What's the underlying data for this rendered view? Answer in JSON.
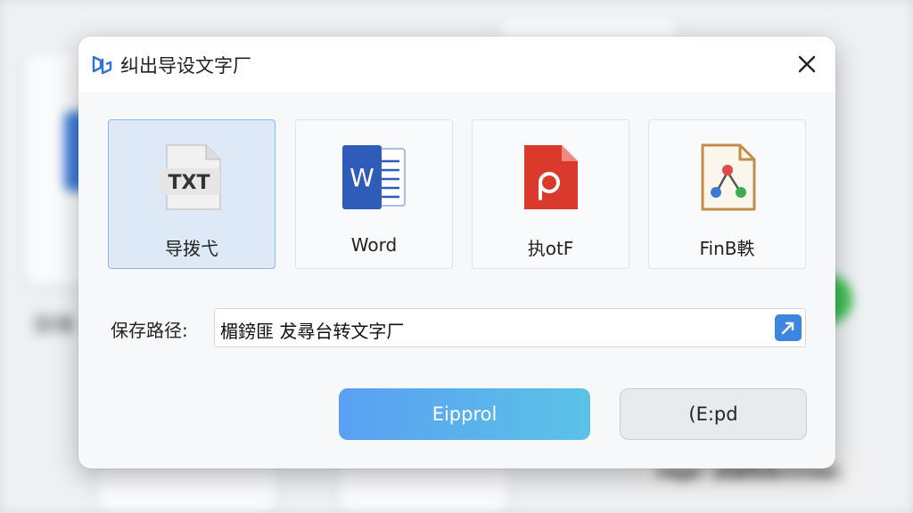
{
  "dialog": {
    "title": "纠出导设文字厂",
    "formats": [
      {
        "label": "导拨弋",
        "icon_text": "TXT",
        "icon": "txt-file-icon",
        "selected": true
      },
      {
        "label": "Word",
        "icon_text": "W",
        "icon": "word-file-icon",
        "selected": false
      },
      {
        "label": "执otF",
        "icon_text": "P",
        "icon": "pdf-file-icon",
        "selected": false
      },
      {
        "label": "FinB軼",
        "icon_text": "",
        "icon": "share-file-icon",
        "selected": false
      }
    ],
    "save_path": {
      "label": "保存路径:",
      "value": "楣鎊匪 犮尋台转文字厂"
    },
    "primary_button": "Eipprol",
    "secondary_button": "(E:pd"
  },
  "background": {
    "side_text": "保睡",
    "bottom_pill_text": "repr \\ABRArrrne\\"
  },
  "colors": {
    "accent": "#3c86e0",
    "selected_bg": "#dde9f7",
    "word_blue": "#2f5cb8",
    "pdf_red": "#d93a2c"
  }
}
